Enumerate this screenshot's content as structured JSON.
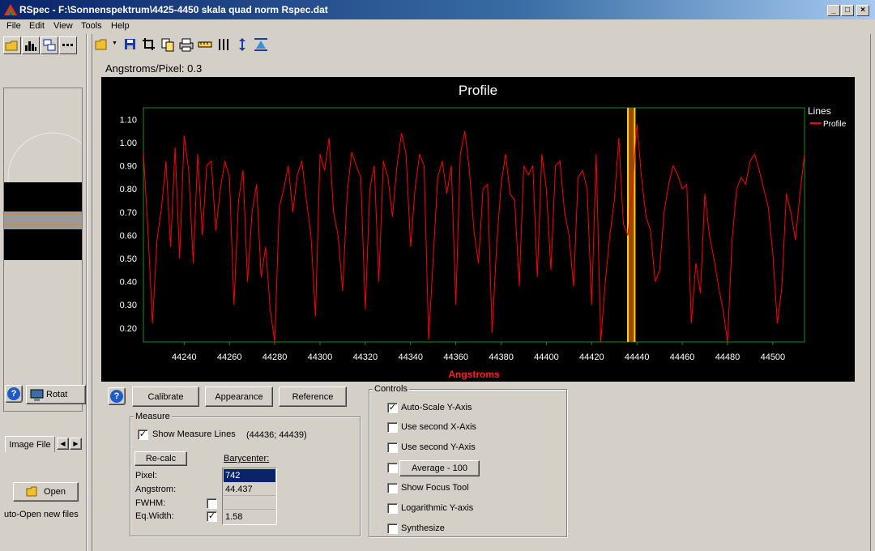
{
  "window": {
    "title": "RSpec - F:\\Sonnenspektrum\\4425-4450 skala quad norm Rspec.dat",
    "minimize": "_",
    "maximize": "□",
    "close": "×"
  },
  "menu": [
    "File",
    "Edit",
    "View",
    "Tools",
    "Help"
  ],
  "left_panel": {
    "help_glyph": "?",
    "rotate_label": "Rotat",
    "tab_label": "Image File",
    "open_label": "Open",
    "auto_open_label": "uto-Open new files"
  },
  "scale_label": "Angstroms/Pixel: 0.3",
  "chart_data": {
    "type": "line",
    "title": "Profile",
    "xlabel": "Angstroms",
    "ylabel": "",
    "xlim": [
      44222,
      44514
    ],
    "ylim": [
      0.14,
      1.15
    ],
    "x_ticks": [
      44240,
      44260,
      44280,
      44300,
      44320,
      44340,
      44360,
      44380,
      44400,
      44420,
      44440,
      44460,
      44480,
      44500
    ],
    "x_tick_labels": [
      "44240",
      "44260",
      "44280",
      "44300",
      "44320",
      "44340",
      "44360",
      "44380",
      "44400",
      "44420",
      "44440",
      "44460",
      "44480",
      "44500"
    ],
    "y_ticks": [
      0.2,
      0.3,
      0.4,
      0.5,
      0.6,
      0.7,
      0.8,
      0.9,
      1.0,
      1.1
    ],
    "y_tick_labels": [
      "0.20",
      "0.30",
      "0.40",
      "0.50",
      "0.60",
      "0.70",
      "0.80",
      "0.90",
      "1.00",
      "1.10"
    ],
    "legend": {
      "title": "Lines",
      "placement": "right"
    },
    "series": [
      {
        "name": "Profile",
        "color": "#ff0000",
        "x": [
          44222,
          44224,
          44226,
          44228,
          44230,
          44232,
          44234,
          44236,
          44238,
          44240,
          44242,
          44244,
          44246,
          44248,
          44250,
          44252,
          44254,
          44256,
          44258,
          44260,
          44262,
          44264,
          44266,
          44268,
          44270,
          44272,
          44274,
          44276,
          44278,
          44280,
          44282,
          44284,
          44286,
          44288,
          44290,
          44292,
          44294,
          44296,
          44298,
          44300,
          44302,
          44304,
          44306,
          44308,
          44310,
          44312,
          44314,
          44316,
          44318,
          44320,
          44322,
          44324,
          44326,
          44328,
          44330,
          44332,
          44334,
          44336,
          44338,
          44340,
          44342,
          44344,
          44346,
          44348,
          44350,
          44352,
          44354,
          44356,
          44358,
          44360,
          44362,
          44364,
          44366,
          44368,
          44370,
          44372,
          44374,
          44376,
          44378,
          44380,
          44382,
          44384,
          44386,
          44388,
          44390,
          44392,
          44394,
          44396,
          44398,
          44400,
          44402,
          44404,
          44406,
          44408,
          44410,
          44412,
          44414,
          44416,
          44418,
          44420,
          44422,
          44424,
          44426,
          44428,
          44430,
          44432,
          44434,
          44436,
          44438,
          44440,
          44442,
          44444,
          44446,
          44448,
          44450,
          44452,
          44454,
          44456,
          44458,
          44460,
          44462,
          44464,
          44466,
          44468,
          44470,
          44472,
          44474,
          44476,
          44478,
          44480,
          44482,
          44484,
          44486,
          44488,
          44490,
          44492,
          44494,
          44496,
          44498,
          44500,
          44502,
          44504,
          44506,
          44508,
          44510,
          44512,
          44514
        ],
        "values": [
          0.96,
          0.62,
          0.22,
          0.58,
          0.72,
          0.92,
          0.55,
          0.98,
          0.5,
          1.03,
          0.88,
          0.48,
          0.95,
          0.6,
          0.9,
          0.92,
          0.62,
          0.8,
          0.92,
          0.85,
          0.3,
          0.75,
          0.88,
          0.4,
          0.7,
          0.82,
          0.42,
          0.55,
          0.28,
          0.12,
          0.72,
          0.8,
          0.9,
          0.7,
          0.86,
          0.92,
          0.75,
          0.6,
          0.25,
          0.95,
          0.88,
          1.02,
          0.7,
          0.6,
          0.36,
          0.78,
          0.96,
          0.9,
          0.85,
          0.28,
          0.8,
          0.9,
          0.4,
          0.92,
          0.85,
          0.68,
          0.9,
          1.04,
          0.95,
          0.55,
          0.8,
          0.95,
          0.9,
          0.15,
          0.5,
          0.85,
          0.92,
          0.78,
          0.9,
          0.3,
          0.95,
          1.05,
          0.88,
          0.62,
          0.48,
          0.8,
          0.82,
          0.18,
          0.55,
          0.82,
          0.95,
          0.78,
          0.75,
          0.38,
          0.9,
          0.86,
          0.9,
          0.42,
          0.95,
          0.8,
          0.45,
          0.9,
          0.92,
          0.7,
          0.6,
          0.38,
          0.85,
          0.88,
          0.8,
          0.3,
          0.95,
          0.1,
          0.4,
          0.6,
          0.75,
          1.02,
          0.65,
          0.6,
          0.8,
          1.08,
          0.85,
          0.68,
          0.62,
          0.4,
          0.45,
          0.7,
          0.82,
          0.9,
          0.86,
          0.8,
          0.82,
          0.22,
          0.48,
          0.35,
          0.78,
          0.6,
          0.5,
          0.38,
          0.28,
          0.12,
          0.58,
          0.8,
          0.85,
          0.82,
          0.92,
          0.95,
          0.88,
          0.8,
          0.72,
          0.52,
          0.22,
          0.38,
          0.78,
          0.7,
          0.58,
          0.78,
          0.95
        ]
      }
    ],
    "measure_band": {
      "x1": 44436,
      "x2": 44439
    },
    "grid": false
  },
  "buttons": {
    "help_glyph": "?",
    "calibrate": "Calibrate",
    "appearance": "Appearance",
    "reference": "Reference"
  },
  "measure": {
    "title": "Measure",
    "show_measure_lines": "Show Measure Lines",
    "show_measure_lines_checked": true,
    "range": "(44436; 44439)",
    "recalc": "Re-calc",
    "barycenter_label": "Barycenter:",
    "pixel_label": "Pixel:",
    "angstrom_label": "Angstrom:",
    "fwhm_label": "FWHM:",
    "eqwidth_label": "Eq.Width:",
    "pixel_value": "742",
    "angstrom_value": "44.437",
    "fwhm_value": "",
    "eqwidth_value": "1.58",
    "fwhm_checked": false,
    "eqwidth_checked": true,
    "check_glyph": "✓"
  },
  "controls": {
    "title": "Controls",
    "items": [
      {
        "label": "Auto-Scale Y-Axis",
        "checked": true
      },
      {
        "label": "Use second X-Axis",
        "checked": false
      },
      {
        "label": "Use second Y-Axis",
        "checked": false
      },
      {
        "label": "Average - 100",
        "checked": false,
        "is_button": true
      },
      {
        "label": "Show Focus Tool",
        "checked": false
      },
      {
        "label": "Logarithmic Y-axis",
        "checked": false
      },
      {
        "label": "Synthesize",
        "checked": false
      }
    ]
  }
}
